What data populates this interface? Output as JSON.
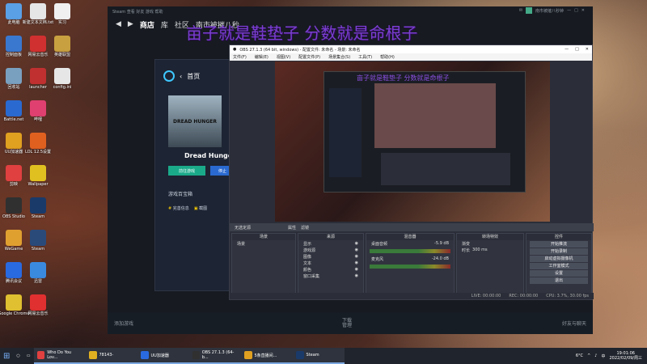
{
  "desktop": {
    "icons": [
      {
        "label": "此电脑",
        "color": "#5aa0e6"
      },
      {
        "label": "新建文本文档.txt",
        "color": "#e6e6e6"
      },
      {
        "label": "实习",
        "color": "#f0f0f0"
      },
      {
        "label": "控制面板",
        "color": "#3a78d0"
      },
      {
        "label": "网易云音乐",
        "color": "#d03030"
      },
      {
        "label": "英雄联盟",
        "color": "#c8a040"
      },
      {
        "label": "回收站",
        "color": "#7aa0c0"
      },
      {
        "label": "launcher",
        "color": "#c03030"
      },
      {
        "label": "config.ini",
        "color": "#e6e6e6"
      },
      {
        "label": "Battle.net",
        "color": "#2a6ad0"
      },
      {
        "label": "哔哩",
        "color": "#e04070"
      },
      {
        "label": "UU加速器",
        "color": "#e0a020"
      },
      {
        "label": "LOL 12.5设置",
        "color": "#e06020"
      },
      {
        "label": "剪映",
        "color": "#e04040"
      },
      {
        "label": "Wallpaper",
        "color": "#e0c020"
      },
      {
        "label": "OBS Studio",
        "color": "#303030"
      },
      {
        "label": "Steam",
        "color": "#1a3a6a"
      },
      {
        "label": "WeGame",
        "color": "#e0a030"
      },
      {
        "label": "Steam",
        "color": "#2a4a7a"
      },
      {
        "label": "腾讯会议",
        "color": "#2a6ae0"
      },
      {
        "label": "迅雷",
        "color": "#3a8ae0"
      },
      {
        "label": "Google Chrome",
        "color": "#e0c030"
      },
      {
        "label": "网易云音乐",
        "color": "#e03030"
      }
    ]
  },
  "steam": {
    "topbar": "Steam 查看 好友 游戏 帮助",
    "nav": [
      "商店",
      "库",
      "社区",
      "南市被摧八秒"
    ],
    "user": "南市被摧八秒钟",
    "overlay_text": "亩子就是鞋垫子 分数就是命根子",
    "bottom": {
      "left": "添加游戏",
      "center_top": "下载",
      "center_bottom": "管理",
      "right": "好友与聊天"
    }
  },
  "game_panel": {
    "home": "首页",
    "cover_text": "DREAD HUNGER",
    "title": "Dread Hunge",
    "primary_btn": "前往游戏",
    "secondary_btn": "停止",
    "section": "游戏百宝箱",
    "tags": [
      "完善信息",
      "截图"
    ]
  },
  "obs": {
    "title": "OBS 27.1.3 (64 bit, windows) - 配置文件: 未命名 - 场景: 未命名",
    "menu": [
      "文件(F)",
      "编辑(E)",
      "视图(V)",
      "配置文件(P)",
      "场景集合(S)",
      "工具(T)",
      "帮助(H)"
    ],
    "nested_overlay": "亩子就是鞋垫子 分数就是命根子",
    "bar": [
      "无选定源",
      "属性",
      "滤镜"
    ],
    "docks": {
      "scenes": {
        "header": "场景",
        "items": [
          "场景"
        ]
      },
      "sources": {
        "header": "来源",
        "items": [
          "显示",
          "游戏源",
          "图像",
          "文本",
          "颜色",
          "窗口采集"
        ]
      },
      "mixer": {
        "header": "混音器",
        "tracks": [
          {
            "name": "桌面音频",
            "db": "-5.9 dB"
          },
          {
            "name": "麦克风",
            "db": "-24.0 dB"
          }
        ]
      },
      "transitions": {
        "header": "转场特效",
        "type": "渐变",
        "duration_label": "时长",
        "duration": "300 ms"
      },
      "controls": {
        "header": "控件",
        "buttons": [
          "开始推流",
          "开始录制",
          "启动虚拟摄像机",
          "工作室模式",
          "设置",
          "退出"
        ]
      }
    },
    "status": [
      "LIVE: 00:00:00",
      "REC: 00:00:00",
      "CPU: 3.7%, 30.00 fps"
    ]
  },
  "taskbar": {
    "apps": [
      {
        "label": "Who Do You Lov...",
        "color": "#e04040"
      },
      {
        "label": "78143-",
        "color": "#e0b020"
      },
      {
        "label": "UU加速器",
        "color": "#2a6ae0"
      },
      {
        "label": "OBS 27.1.3 (64-b...",
        "color": "#303030"
      },
      {
        "label": "5条直播间...",
        "color": "#e0a020"
      },
      {
        "label": "Steam",
        "color": "#1a3a6a"
      }
    ],
    "weather": "6°C",
    "time": "19:01:06",
    "date": "2022/02/09/周三"
  }
}
